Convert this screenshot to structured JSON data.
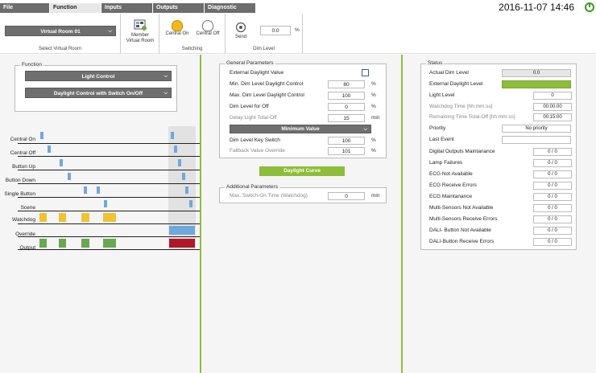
{
  "tabs": [
    "File",
    "Function",
    "Inputs",
    "Outputs",
    "Diagnostic"
  ],
  "datetime": "2016-11-07 14:46",
  "ribbon": {
    "virtual_room_select": "Virtual Room 01",
    "select_label": "Select Virtual Room",
    "member_label": "Member Virtual Room",
    "member_group": "Virtual Room",
    "central_on": "Central On",
    "central_off": "Central Off",
    "switching_label": "Switching",
    "send_label": "Send",
    "dim_value": "0.0",
    "dim_unit": "%",
    "dim_label": "Dim Level"
  },
  "function_panel": {
    "legend": "Function",
    "select1": "Light Control",
    "select2": "Daylight Control with Switch On/Off",
    "timeline_labels": [
      "Central On",
      "Central Off",
      "Button Up",
      "Button Down",
      "Single Button",
      "Scene",
      "Watchdog",
      "Override",
      "Output"
    ]
  },
  "general": {
    "legend": "General Parameters",
    "external_daylight": "External Daylight Value",
    "rows": [
      {
        "label": "Min. Dim Level Daylight Control",
        "value": "80",
        "unit": "%",
        "dim": false
      },
      {
        "label": "Max. Dim Level Daylight Control",
        "value": "100",
        "unit": "%",
        "dim": false
      },
      {
        "label": "Dim Level for Off",
        "value": "0",
        "unit": "%",
        "dim": false
      },
      {
        "label": "Delay Light Total-Off",
        "value": "15",
        "unit": "min",
        "dim": true
      }
    ],
    "minimum_select": "Minimum Value",
    "rows2": [
      {
        "label": "Dim Level Key Switch",
        "value": "100",
        "unit": "%",
        "dim": false
      },
      {
        "label": "Fallback Value Override",
        "value": "101",
        "unit": "%",
        "dim": true
      }
    ],
    "daylight_curve": "Daylight Curve",
    "additional_legend": "Additional Parameters",
    "max_switch_label": "Max. Switch-On Time (Watchdog)",
    "max_switch_value": "0",
    "max_switch_unit": "min"
  },
  "status": {
    "legend": "Status",
    "rows": [
      {
        "label": "Actual Dim Level",
        "value": "0.0",
        "style": "gray",
        "dim": false
      },
      {
        "label": "External Daylight Level",
        "value": "",
        "style": "green",
        "dim": false
      },
      {
        "label": "Light Level",
        "value": "0",
        "style": "",
        "dim": false
      },
      {
        "label": "Watchdog Time [hh:mm:ss]",
        "value": "00:00:00",
        "style": "",
        "dim": true
      },
      {
        "label": "Remaining Time Total-Off [hh:mm:ss]",
        "value": "00:15:00",
        "style": "",
        "dim": true
      },
      {
        "label": "Priority",
        "value": "No priority",
        "style": "",
        "dim": false
      },
      {
        "label": "Last Event",
        "value": "",
        "style": "",
        "dim": false
      },
      {
        "label": "Digital Outputs Maintanance",
        "value": "0 / 0",
        "style": "",
        "dim": false
      },
      {
        "label": "Lamp Failures",
        "value": "0 / 0",
        "style": "",
        "dim": false
      },
      {
        "label": "ECG Not Available",
        "value": "0 / 0",
        "style": "",
        "dim": false
      },
      {
        "label": "ECG Receive Errors",
        "value": "0 / 0",
        "style": "",
        "dim": false
      },
      {
        "label": "ECG Maintanance",
        "value": "0 / 0",
        "style": "",
        "dim": false
      },
      {
        "label": "Multi-Sensors Not Available",
        "value": "0 / 0",
        "style": "",
        "dim": false
      },
      {
        "label": "Multi-Sensors Receive Errors",
        "value": "0 / 0",
        "style": "",
        "dim": false
      },
      {
        "label": "DALI- Button Not Available",
        "value": "0 / 0",
        "style": "",
        "dim": false
      },
      {
        "label": "DALI-Button Receive Errors",
        "value": "0 / 0",
        "style": "",
        "dim": false
      }
    ]
  },
  "colors": {
    "accent": "#8dbd3a",
    "blue": "#6fa8dc",
    "yellow": "#f1c232",
    "green": "#6aa84f",
    "red": "#b0182a"
  }
}
